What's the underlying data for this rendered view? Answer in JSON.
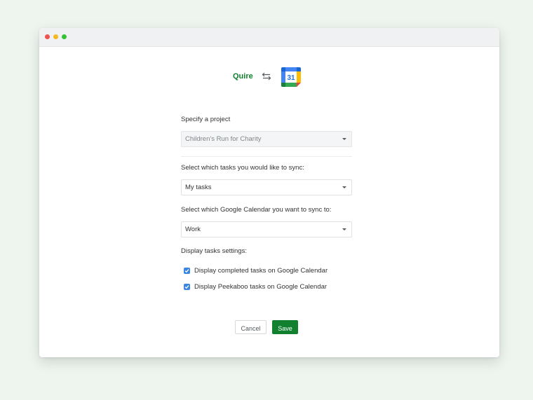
{
  "header": {
    "app_logo": "Quire",
    "sync_icon": "arrows-exchange-icon",
    "calendar_icon": "google-calendar-icon",
    "calendar_day": "31"
  },
  "form": {
    "project_label": "Specify a project",
    "project_value": "Children's Run for Charity",
    "tasks_label": "Select which tasks you would like to sync:",
    "tasks_value": "My tasks",
    "calendar_label": "Select which Google Calendar you want to sync to:",
    "calendar_value": "Work",
    "display_label": "Display tasks settings:",
    "checkboxes": [
      {
        "label": "Display completed tasks on Google Calendar",
        "checked": true
      },
      {
        "label": "Display Peekaboo tasks on Google Calendar",
        "checked": true
      }
    ]
  },
  "buttons": {
    "cancel": "Cancel",
    "save": "Save"
  },
  "colors": {
    "brand_green": "#11802f",
    "checkbox_blue": "#3b86e0",
    "background": "#eef5ef"
  }
}
